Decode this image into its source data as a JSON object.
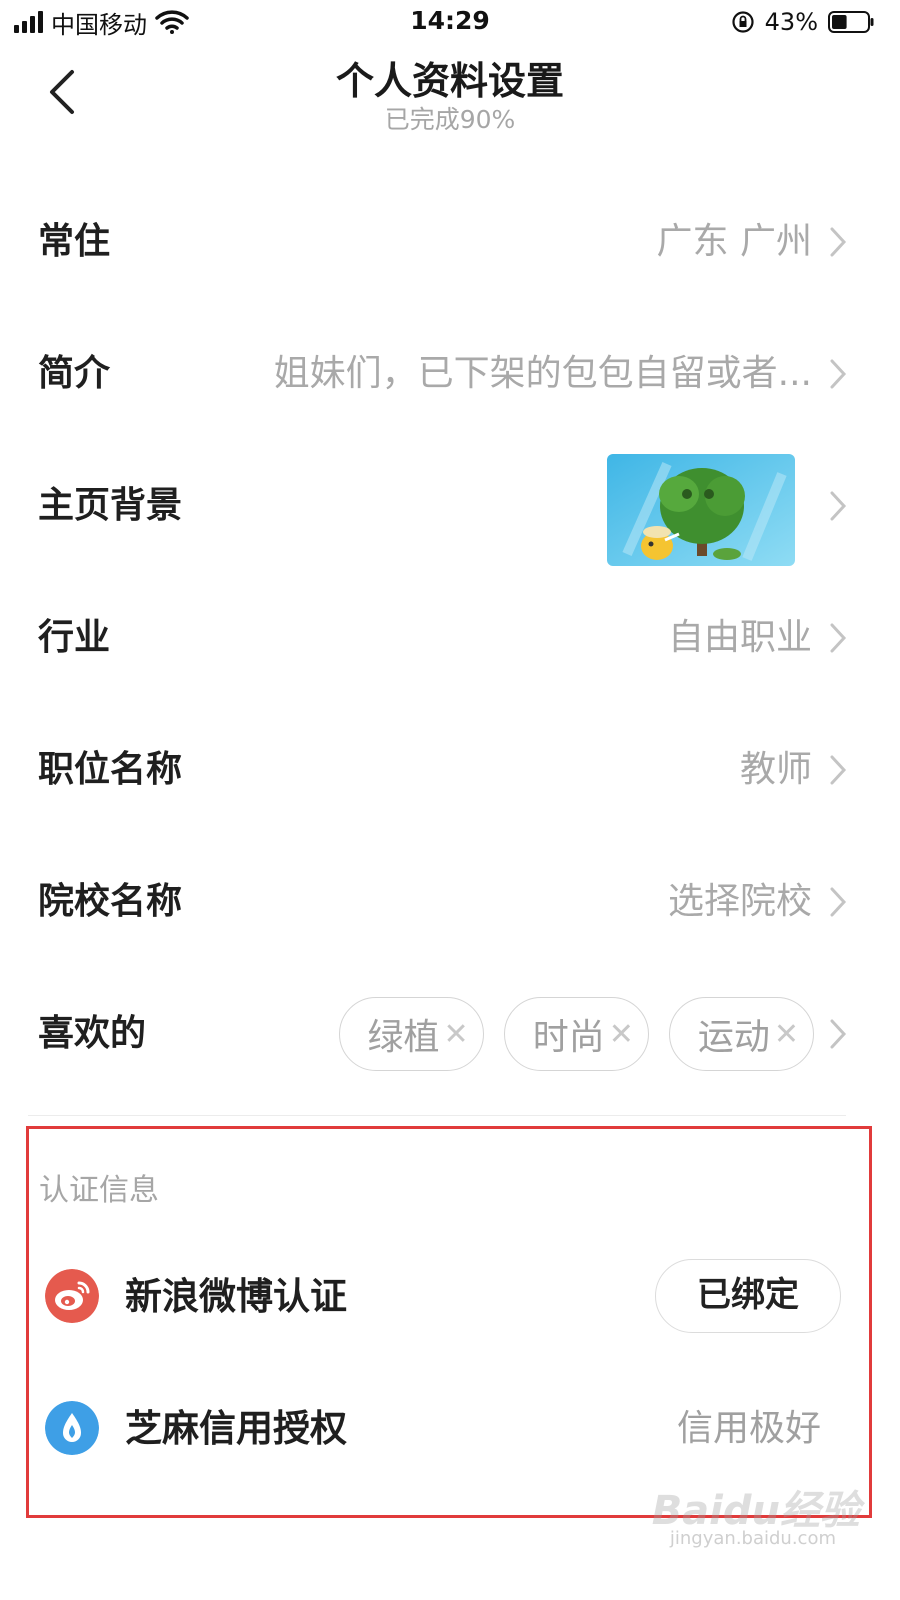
{
  "status_bar": {
    "carrier": "中国移动",
    "time": "14:29",
    "battery": "43%",
    "battery_level": 0.43
  },
  "nav": {
    "title": "个人资料设置",
    "subtitle": "已完成90%"
  },
  "rows": [
    {
      "label": "常住",
      "value": "广东  广州"
    },
    {
      "label": "简介",
      "value": "姐妹们，已下架的包包自留或者..."
    },
    {
      "label": "主页背景",
      "value": ""
    },
    {
      "label": "行业",
      "value": "自由职业"
    },
    {
      "label": "职位名称",
      "value": "教师"
    },
    {
      "label": "院校名称",
      "value": "选择院校"
    },
    {
      "label": "喜欢的",
      "tags": [
        "绿植",
        "时尚",
        "运动"
      ]
    }
  ],
  "certification": {
    "title": "认证信息",
    "weibo": {
      "label": "新浪微博认证",
      "button": "已绑定",
      "icon_color": "#e55a4e"
    },
    "zhima": {
      "label": "芝麻信用授权",
      "value": "信用极好",
      "icon_color": "#3e9fe6"
    }
  },
  "watermark": {
    "brand": "Baidu经验",
    "url": "jingyan.baidu.com"
  }
}
